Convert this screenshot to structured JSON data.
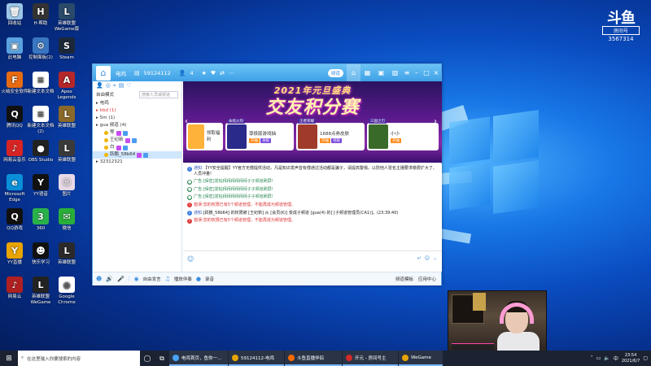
{
  "desktop": {
    "icons": [
      {
        "label": "回收站",
        "color": "#9ec7e8",
        "glyph": "🗑"
      },
      {
        "label": "H·帮助",
        "color": "#333333",
        "glyph": "H"
      },
      {
        "label": "英雄联盟WeGame版",
        "color": "#2a4a6a",
        "glyph": "L"
      },
      {
        "label": "此电脑",
        "color": "#5aa3e0",
        "glyph": "▣"
      },
      {
        "label": "控制面板(2)",
        "color": "#3a76c0",
        "glyph": "⚙"
      },
      {
        "label": "Steam",
        "color": "#1b2838",
        "glyph": "S"
      },
      {
        "label": "火绒安全软件",
        "color": "#e66b12",
        "glyph": "F"
      },
      {
        "label": "新建文本文档",
        "color": "#ffffff",
        "glyph": "≡"
      },
      {
        "label": "Apex Legends",
        "color": "#b4272b",
        "glyph": "A"
      },
      {
        "label": "腾讯QQ",
        "color": "#111111",
        "glyph": "Q"
      },
      {
        "label": "新建文本文档(2)",
        "color": "#ffffff",
        "glyph": "≡"
      },
      {
        "label": "英雄联盟",
        "color": "#8a6a2a",
        "glyph": "L"
      },
      {
        "label": "网易云音乐",
        "color": "#d62424",
        "glyph": "♪"
      },
      {
        "label": "OBS Studio",
        "color": "#222222",
        "glyph": "●"
      },
      {
        "label": "英雄联盟",
        "color": "#3a3a3a",
        "glyph": "L"
      },
      {
        "label": "Microsoft Edge",
        "color": "#0b8fd8",
        "glyph": "e"
      },
      {
        "label": "YY语音",
        "color": "#111111",
        "glyph": "Y"
      },
      {
        "label": "图片",
        "color": "#e8d9e8",
        "glyph": "☺"
      },
      {
        "label": "QQ游戏",
        "color": "#111111",
        "glyph": "Q"
      },
      {
        "label": "360",
        "color": "#2ab24a",
        "glyph": "3"
      },
      {
        "label": "微信",
        "color": "#2aae3a",
        "glyph": "✉"
      },
      {
        "label": "YY直播",
        "color": "#e8a400",
        "glyph": "Y"
      },
      {
        "label": "快乐学习",
        "color": "#111111",
        "glyph": "☻"
      },
      {
        "label": "英雄联盟",
        "color": "#2a2a2a",
        "glyph": "L"
      },
      {
        "label": "网易云",
        "color": "#b02020",
        "glyph": "♪"
      },
      {
        "label": "英雄联盟WeGame",
        "color": "#222222",
        "glyph": "L"
      },
      {
        "label": "Google Chrome",
        "color": "#ffffff",
        "glyph": "◉"
      }
    ]
  },
  "watermark": {
    "logo": "斗鱼",
    "tag": "房间号",
    "room": "3567314"
  },
  "yy": {
    "title": "电鸡",
    "channel_id": "59124112",
    "online": "4",
    "pill": "频道",
    "tree_mode": "自由模式",
    "search_placeholder": "搜索人员或频道",
    "tree": [
      {
        "text": "电鸡",
        "color": "#333",
        "indent": 0
      },
      {
        "text": "kbd (1)",
        "color": "#d33",
        "indent": 0
      },
      {
        "text": "5m (1)",
        "color": "#333",
        "indent": 0
      },
      {
        "text": "gua 频道 (4)",
        "color": "#333",
        "indent": 0
      },
      {
        "text": "等",
        "color": "#333",
        "indent": 1
      },
      {
        "text": "王纪新",
        "color": "#333",
        "indent": 1
      },
      {
        "text": "白",
        "color": "#333",
        "indent": 1
      },
      {
        "text": "跃鹏_58b64",
        "color": "#333",
        "indent": 1,
        "selected": true
      },
      {
        "text": "32312321",
        "color": "#333",
        "indent": 0
      }
    ],
    "banner": {
      "subtitle": "2021年元旦盛典",
      "title": "交友积分赛"
    },
    "cards": [
      {
        "tag": "",
        "name": "领取福利",
        "thumb": "#ffb23a",
        "btn1": ""
      },
      {
        "tag": "永续火热",
        "name": "尊极版游戏抽",
        "thumb": "#2a2a8a",
        "btn1": "开抽",
        "btn2": "领取"
      },
      {
        "tag": "王者荣耀",
        "name": "1688点券皮肤",
        "thumb": "#a03a2a",
        "btn1": "开抽",
        "btn2": "领取"
      },
      {
        "tag": "三国之刃",
        "name": "小小",
        "thumb": "#3a6a2a",
        "btn1": "开抽"
      }
    ],
    "messages": [
      {
        "type": "notice",
        "label": "通知:",
        "text": "【YY安全提醒】YY官方无偿提供活动，凡是知识发声音有偿通过活动都是骗子，请提高警惕，以防他人冒名主播要求缴费扩大了、人员冲量!"
      },
      {
        "type": "ad",
        "label": "",
        "text": "广告:[保密]发帖拜拜拜拜拜拜子子频道刷屏!"
      },
      {
        "type": "ad",
        "label": "",
        "text": "广告:[保密]发帖拜拜拜拜拜拜子子频道刷屏!"
      },
      {
        "type": "ad",
        "label": "",
        "text": "广告:[保密]发帖拜拜拜拜拜拜子子频道刷屏!"
      },
      {
        "type": "warn",
        "label": "错误:",
        "text": "您的权限已有5个频道管理，不能再成为频道管理。"
      },
      {
        "type": "notice",
        "label": "通知:",
        "text": "[跃鹏_58b64] 的权限被 [王纪新] 从 [会员(K)] 变成子频道 [gua(4) 的] [子频道管理员(CA1)]。(23:39:40)"
      },
      {
        "type": "warn",
        "label": "错误:",
        "text": "您的权限已有5个频道管理，不能再成为频道管理。"
      }
    ],
    "bottom": {
      "mode": "自由发言",
      "broadcast": "播放伴奏",
      "record": "录音",
      "settings": "频道模板",
      "apps": "应用中心"
    }
  },
  "taskbar": {
    "search_placeholder": "在这里输入你要搜索的内容",
    "apps": [
      {
        "label": "电鸡首页，鱼你一...",
        "color": "#4aa3ff"
      },
      {
        "label": "59124112-电鸡",
        "color": "#e8a400"
      },
      {
        "label": "斗鱼直播伴侣",
        "color": "#ff6a00"
      },
      {
        "label": "开元 - 房间号主",
        "color": "#d32a2a"
      },
      {
        "label": "WeGame",
        "color": "#e8a400"
      }
    ],
    "time": "23:54",
    "date": "2021/6/7"
  }
}
